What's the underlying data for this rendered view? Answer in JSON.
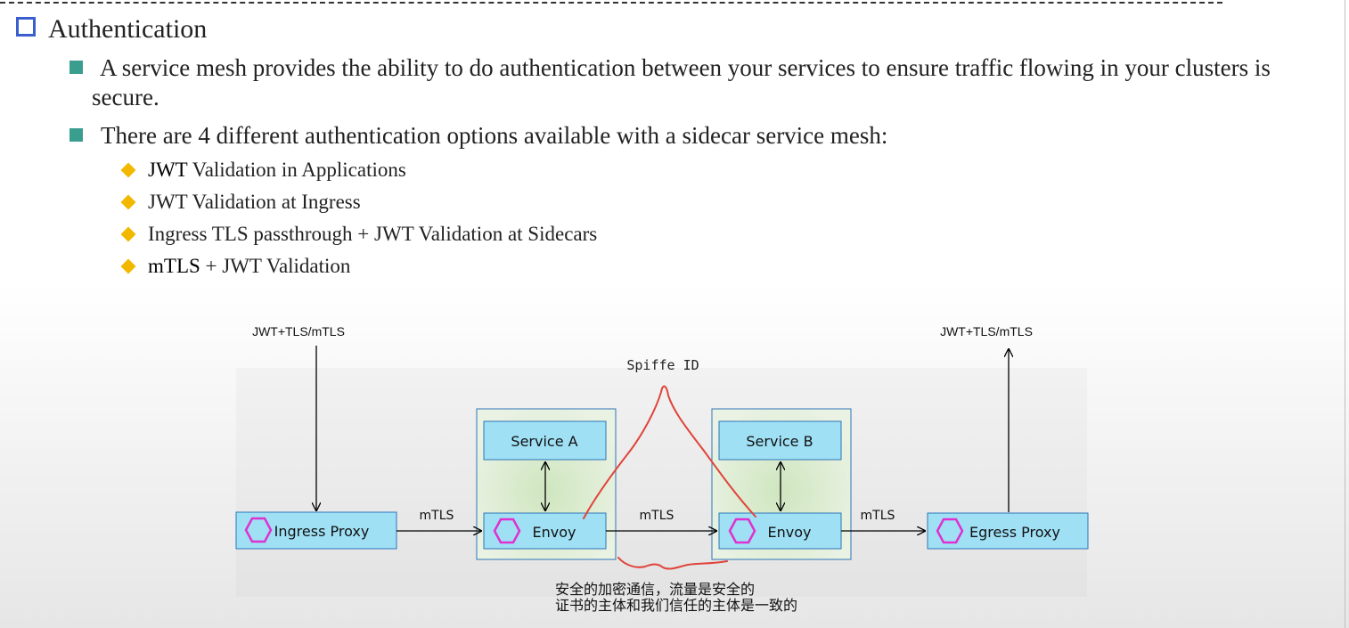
{
  "heading": "Authentication",
  "bullets": [
    "A service mesh provides the ability to do authentication between your services to ensure traffic flowing in your clusters is secure.",
    "There are 4 different authentication options available with a sidecar service mesh:"
  ],
  "options": [
    {
      "strong": "JWT",
      "rest": " Validation in Applications"
    },
    {
      "strong": "",
      "rest": "JWT Validation at Ingress"
    },
    {
      "strong": "",
      "rest": "Ingress TLS passthrough + JWT Validation at Sidecars"
    },
    {
      "strong": "mTLS",
      "rest": " + JWT Validation"
    }
  ],
  "diagram": {
    "ingress_label_top": "JWT+TLS/mTLS",
    "egress_label_top": "JWT+TLS/mTLS",
    "spiffe": "Spiffe ID",
    "ingress_proxy": "Ingress Proxy",
    "egress_proxy": "Egress Proxy",
    "service_a": "Service A",
    "service_b": "Service B",
    "envoy": "Envoy",
    "mtls": "mTLS",
    "colors": {
      "box_fill": "#9fe0f5",
      "box_stroke": "#2e75b6",
      "hex": "#e030d0",
      "pod_fill": "#cfe6c2",
      "annotation": "#e0443a"
    }
  },
  "note": [
    "安全的加密通信，流量是安全的",
    "证书的主体和我们信任的主体是一致的"
  ]
}
